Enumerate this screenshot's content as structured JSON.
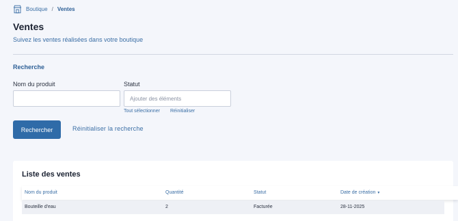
{
  "breadcrumb": {
    "home": "Boutique",
    "separator": "/",
    "current": "Ventes",
    "icon": "shop-icon"
  },
  "header": {
    "title": "Ventes",
    "subtitle": "Suivez les ventes réalisées dans votre boutique"
  },
  "search": {
    "section_title": "Recherche",
    "product_label": "Nom du produit",
    "product_value": "",
    "status_label": "Statut",
    "status_placeholder": "Ajouter des éléments",
    "select_all": "Tout sélectionner",
    "reset_status": "Réinitialiser",
    "submit_label": "Rechercher",
    "reset_label": "Réinitialiser la recherche"
  },
  "sales": {
    "title": "Liste des ventes",
    "columns": [
      "Nom du produit",
      "Quantité",
      "Statut",
      "Date de création"
    ],
    "sort_indicator": "▼",
    "rows": [
      {
        "product": "Bouteille d'eau",
        "quantity": "2",
        "status": "Facturée",
        "date": "28-11-2025"
      }
    ]
  },
  "colors": {
    "accent": "#2f6ba8",
    "link": "#3a6ea5",
    "background": "#f4f6fb"
  }
}
